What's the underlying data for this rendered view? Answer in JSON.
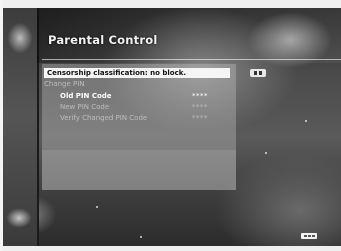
{
  "screen": {
    "title": "Parental Control"
  },
  "menu": {
    "censorship_row": "Censorship classification: no block.",
    "change_pin": "Change PIN",
    "old_pin_label": "Old PIN Code",
    "old_pin_value": "****",
    "new_pin_label": "New PIN Code",
    "new_pin_value": "****",
    "verify_pin_label": "Verify Changed PIN Code",
    "verify_pin_value": "****"
  },
  "icons": {
    "lock_badge": "lock-toggle-icon",
    "ok_button": "ok-button-icon"
  },
  "colors": {
    "highlight": "#f5f5f5",
    "active_text": "#ffffff",
    "dim_text": "#bdbdbd"
  }
}
